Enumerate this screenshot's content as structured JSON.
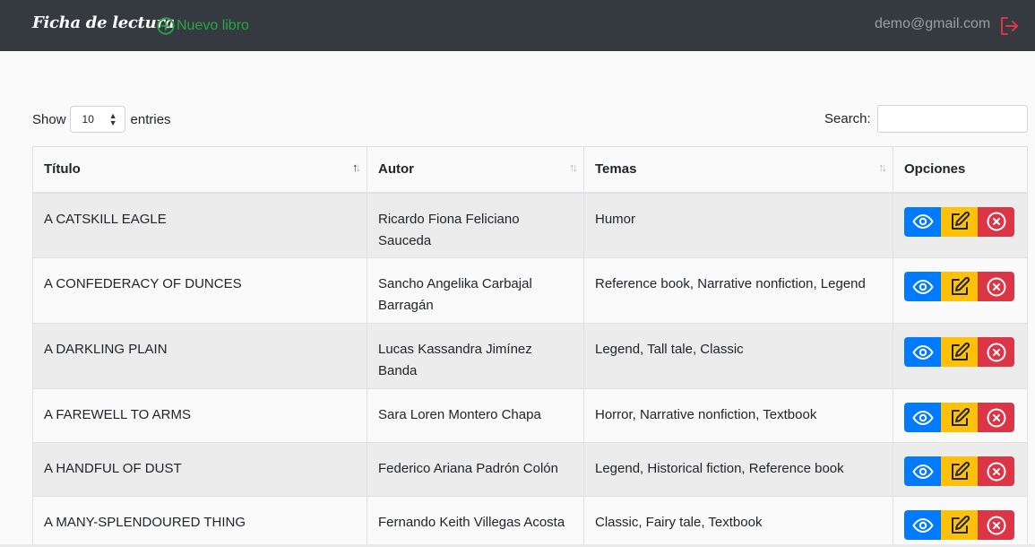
{
  "navbar": {
    "brand": "Ficha de lectura",
    "new_book_label": "Nuevo libro",
    "user_email": "demo@gmail.com"
  },
  "controls": {
    "show_label": "Show",
    "entries_value": "10",
    "entries_label": "entries",
    "search_label": "Search:",
    "search_value": ""
  },
  "table": {
    "headers": {
      "title": "Título",
      "author": "Autor",
      "themes": "Temas",
      "options": "Opciones"
    },
    "rows": [
      {
        "title": "A CATSKILL EAGLE",
        "author": "Ricardo Fiona Feliciano Sauceda",
        "themes": "Humor"
      },
      {
        "title": "A CONFEDERACY OF DUNCES",
        "author": "Sancho Angelika Carbajal Barragán",
        "themes": "Reference book, Narrative nonfiction, Legend"
      },
      {
        "title": "A DARKLING PLAIN",
        "author": "Lucas Kassandra Jimínez Banda",
        "themes": "Legend, Tall tale, Classic"
      },
      {
        "title": "A FAREWELL TO ARMS",
        "author": "Sara Loren Montero Chapa",
        "themes": "Horror, Narrative nonfiction, Textbook"
      },
      {
        "title": "A HANDFUL OF DUST",
        "author": "Federico Ariana Padrón Colón",
        "themes": "Legend, Historical fiction, Reference book"
      },
      {
        "title": "A MANY-SPLENDOURED THING",
        "author": "Fernando Keith Villegas Acosta",
        "themes": "Classic, Fairy tale, Textbook"
      }
    ]
  },
  "colors": {
    "navbar_bg": "#343a40",
    "success": "#28a745",
    "primary": "#007bff",
    "warning": "#ffc107",
    "danger": "#dc3545"
  },
  "icons": {
    "new_book": "plus-circle-icon",
    "logout": "logout-icon",
    "view": "eye-icon",
    "edit": "edit-icon",
    "delete": "x-circle-icon"
  }
}
